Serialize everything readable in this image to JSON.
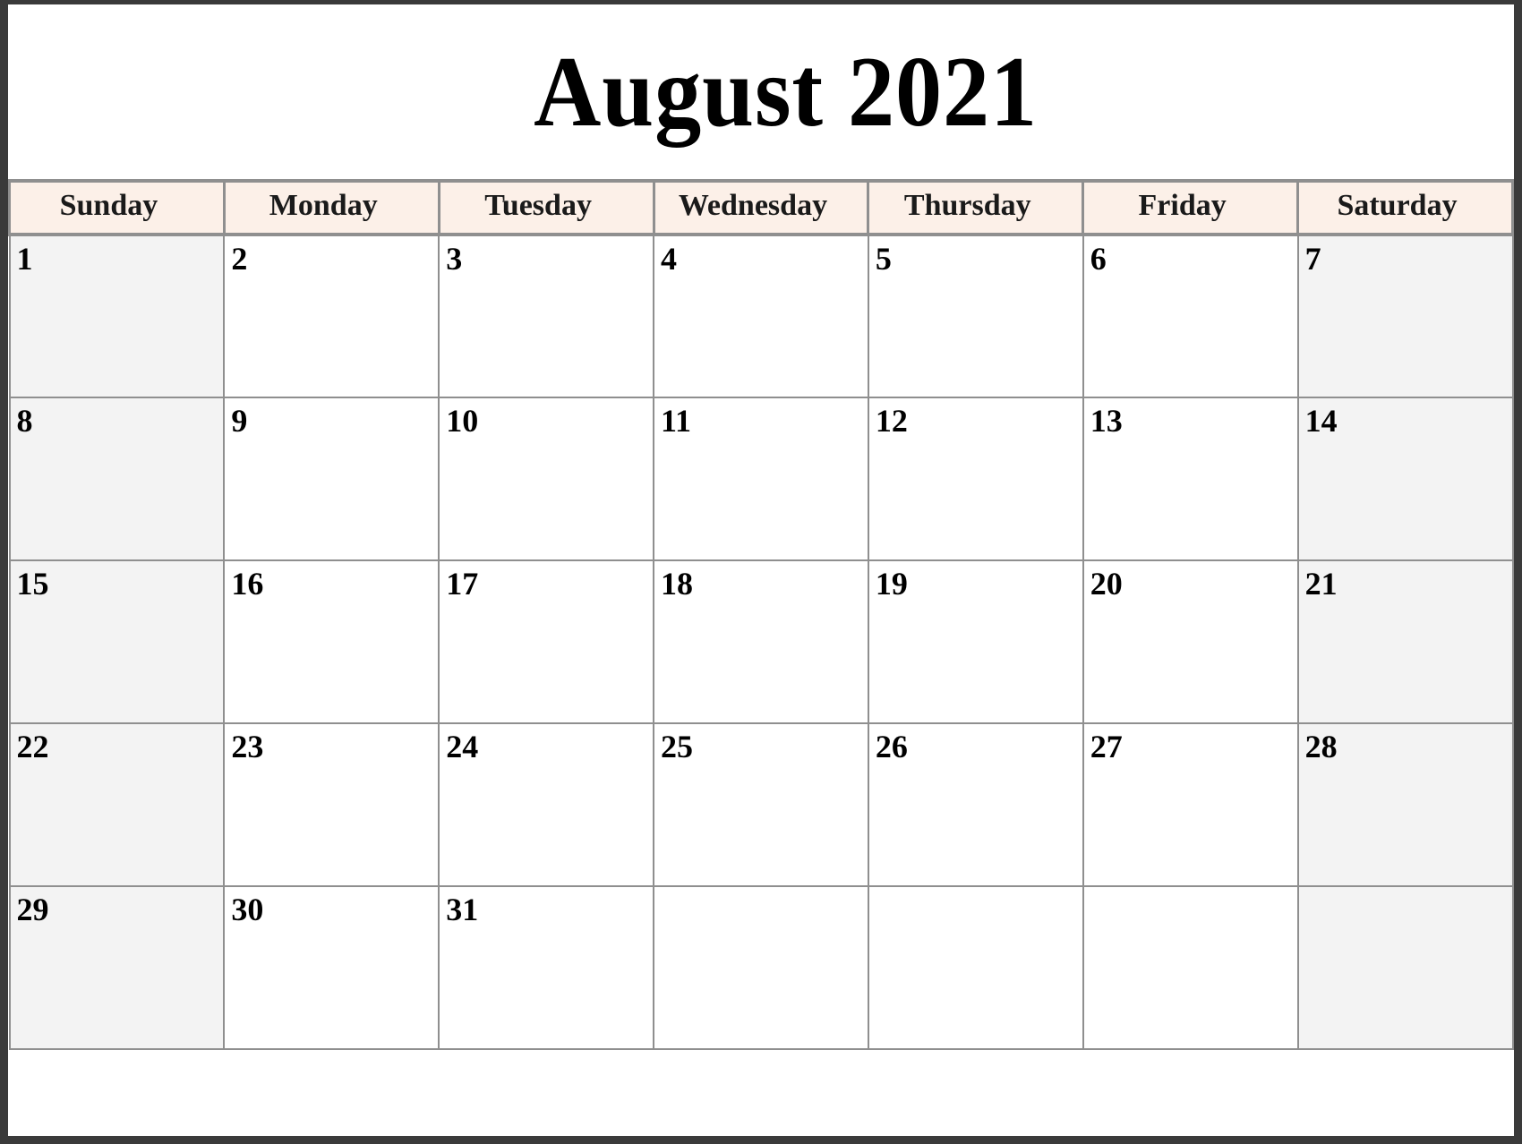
{
  "title": "August 2021",
  "colors": {
    "header_background": "#fcf0e8",
    "weekend_cell_background": "#f3f3f3",
    "weekday_cell_background": "#ffffff",
    "grid_line": "#8f8f8f",
    "outer_border": "#3a3a3a",
    "text": "#000000"
  },
  "weekday_headers": [
    "Sunday",
    "Monday",
    "Tuesday",
    "Wednesday",
    "Thursday",
    "Friday",
    "Saturday"
  ],
  "weeks": [
    {
      "days": [
        "1",
        "2",
        "3",
        "4",
        "5",
        "6",
        "7"
      ]
    },
    {
      "days": [
        "8",
        "9",
        "10",
        "11",
        "12",
        "13",
        "14"
      ]
    },
    {
      "days": [
        "15",
        "16",
        "17",
        "18",
        "19",
        "20",
        "21"
      ]
    },
    {
      "days": [
        "22",
        "23",
        "24",
        "25",
        "26",
        "27",
        "28"
      ]
    },
    {
      "days": [
        "29",
        "30",
        "31",
        "",
        "",
        "",
        ""
      ]
    }
  ]
}
